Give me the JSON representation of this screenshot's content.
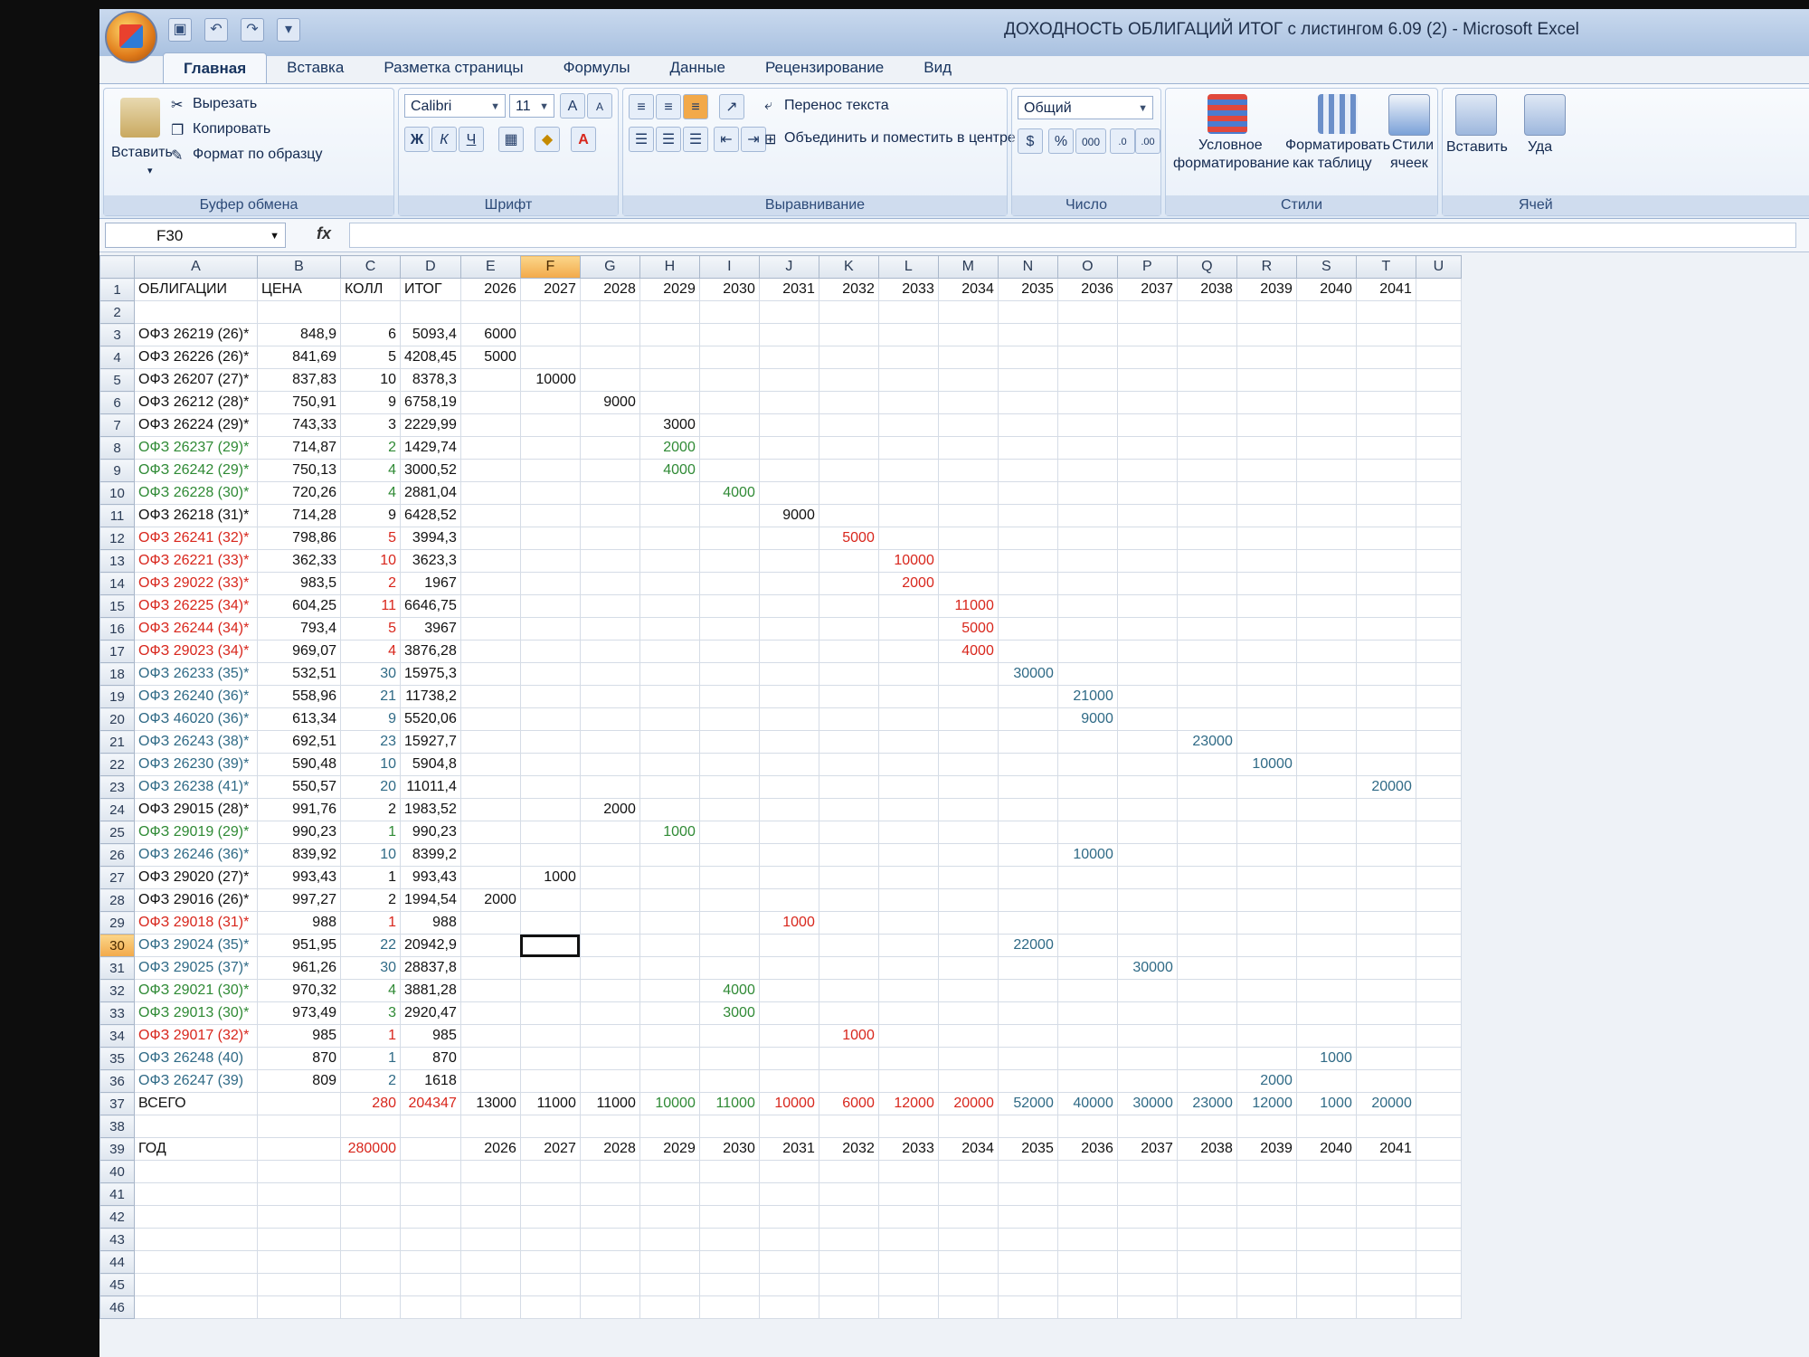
{
  "window": {
    "title": "ДОХОДНОСТЬ ОБЛИГАЦИЙ ИТОГ с листингом 6.09 (2) - Microsoft Excel"
  },
  "ribbon": {
    "tabs": [
      "Главная",
      "Вставка",
      "Разметка страницы",
      "Формулы",
      "Данные",
      "Рецензирование",
      "Вид"
    ],
    "clipboard": {
      "paste": "Вставить",
      "cut": "Вырезать",
      "copy": "Копировать",
      "format_painter": "Формат по образцу",
      "label": "Буфер обмена"
    },
    "font": {
      "name": "Calibri",
      "size": "11",
      "bold": "Ж",
      "italic": "К",
      "underline": "Ч",
      "label": "Шрифт"
    },
    "alignment": {
      "wrap": "Перенос текста",
      "merge": "Объединить и поместить в центре",
      "label": "Выравнивание"
    },
    "number": {
      "format": "Общий",
      "percent": "%",
      "thousands": "000",
      "label": "Число"
    },
    "styles": {
      "conditional": [
        "Условное",
        "форматирование"
      ],
      "as_table": [
        "Форматировать",
        "как таблицу"
      ],
      "cell_styles": [
        "Стили",
        "ячеек"
      ],
      "label": "Стили"
    },
    "cells": {
      "insert": "Вставить",
      "delete": "Уда",
      "label": "Ячей"
    }
  },
  "formula_bar": {
    "name_box": "F30",
    "fx": "fx",
    "content": ""
  },
  "columns": [
    "A",
    "B",
    "C",
    "D",
    "E",
    "F",
    "G",
    "H",
    "I",
    "J",
    "K",
    "L",
    "M",
    "N",
    "O",
    "P",
    "Q",
    "R",
    "S",
    "T",
    "U"
  ],
  "selected_column": "F",
  "selected_row": 30,
  "header_row": [
    "ОБЛИГАЦИИ",
    "ЦЕНА",
    "КОЛЛ",
    "ИТОГ",
    "2026",
    "2027",
    "2028",
    "2029",
    "2030",
    "2031",
    "2032",
    "2033",
    "2034",
    "2035",
    "2036",
    "2037",
    "2038",
    "2039",
    "2040",
    "2041",
    ""
  ],
  "bonds": [
    {
      "name": "ОФЗ 26219 (26)*",
      "price": "848,9",
      "qty": "6",
      "total": "5093,4",
      "col": "E",
      "val": "6000",
      "color": "black"
    },
    {
      "name": "ОФЗ 26226 (26)*",
      "price": "841,69",
      "qty": "5",
      "total": "4208,45",
      "col": "E",
      "val": "5000",
      "color": "black"
    },
    {
      "name": "ОФЗ 26207 (27)*",
      "price": "837,83",
      "qty": "10",
      "total": "8378,3",
      "col": "F",
      "val": "10000",
      "color": "black"
    },
    {
      "name": "ОФЗ 26212 (28)*",
      "price": "750,91",
      "qty": "9",
      "total": "6758,19",
      "col": "G",
      "val": "9000",
      "color": "black"
    },
    {
      "name": "ОФЗ 26224 (29)*",
      "price": "743,33",
      "qty": "3",
      "total": "2229,99",
      "col": "H",
      "val": "3000",
      "color": "black"
    },
    {
      "name": "ОФЗ 26237 (29)*",
      "price": "714,87",
      "qty": "2",
      "total": "1429,74",
      "col": "H",
      "val": "2000",
      "color": "green"
    },
    {
      "name": "ОФЗ 26242 (29)*",
      "price": "750,13",
      "qty": "4",
      "total": "3000,52",
      "col": "H",
      "val": "4000",
      "color": "green"
    },
    {
      "name": "ОФЗ 26228 (30)*",
      "price": "720,26",
      "qty": "4",
      "total": "2881,04",
      "col": "I",
      "val": "4000",
      "color": "green"
    },
    {
      "name": "ОФЗ 26218 (31)*",
      "price": "714,28",
      "qty": "9",
      "total": "6428,52",
      "col": "J",
      "val": "9000",
      "color": "black"
    },
    {
      "name": "ОФЗ 26241 (32)*",
      "price": "798,86",
      "qty": "5",
      "total": "3994,3",
      "col": "K",
      "val": "5000",
      "color": "red"
    },
    {
      "name": "ОФЗ 26221 (33)*",
      "price": "362,33",
      "qty": "10",
      "total": "3623,3",
      "col": "L",
      "val": "10000",
      "color": "red"
    },
    {
      "name": "ОФЗ 29022 (33)*",
      "price": "983,5",
      "qty": "2",
      "total": "1967",
      "col": "L",
      "val": "2000",
      "color": "red"
    },
    {
      "name": "ОФЗ 26225 (34)*",
      "price": "604,25",
      "qty": "11",
      "total": "6646,75",
      "col": "M",
      "val": "11000",
      "color": "red"
    },
    {
      "name": "ОФЗ 26244 (34)*",
      "price": "793,4",
      "qty": "5",
      "total": "3967",
      "col": "M",
      "val": "5000",
      "color": "red"
    },
    {
      "name": "ОФЗ 29023 (34)*",
      "price": "969,07",
      "qty": "4",
      "total": "3876,28",
      "col": "M",
      "val": "4000",
      "color": "red"
    },
    {
      "name": "ОФЗ 26233 (35)*",
      "price": "532,51",
      "qty": "30",
      "total": "15975,3",
      "col": "N",
      "val": "30000",
      "color": "teal"
    },
    {
      "name": "ОФЗ 26240 (36)*",
      "price": "558,96",
      "qty": "21",
      "total": "11738,2",
      "col": "O",
      "val": "21000",
      "color": "teal"
    },
    {
      "name": "ОФЗ 46020 (36)*",
      "price": "613,34",
      "qty": "9",
      "total": "5520,06",
      "col": "O",
      "val": "9000",
      "color": "teal"
    },
    {
      "name": "ОФЗ 26243 (38)*",
      "price": "692,51",
      "qty": "23",
      "total": "15927,7",
      "col": "Q",
      "val": "23000",
      "color": "teal"
    },
    {
      "name": "ОФЗ 26230 (39)*",
      "price": "590,48",
      "qty": "10",
      "total": "5904,8",
      "col": "R",
      "val": "10000",
      "color": "teal"
    },
    {
      "name": "ОФЗ 26238 (41)*",
      "price": "550,57",
      "qty": "20",
      "total": "11011,4",
      "col": "T",
      "val": "20000",
      "color": "teal"
    },
    {
      "name": "ОФЗ 29015 (28)*",
      "price": "991,76",
      "qty": "2",
      "total": "1983,52",
      "col": "G",
      "val": "2000",
      "color": "black"
    },
    {
      "name": "ОФЗ 29019 (29)*",
      "price": "990,23",
      "qty": "1",
      "total": "990,23",
      "col": "H",
      "val": "1000",
      "color": "green"
    },
    {
      "name": "ОФЗ 26246 (36)*",
      "price": "839,92",
      "qty": "10",
      "total": "8399,2",
      "col": "O",
      "val": "10000",
      "color": "teal"
    },
    {
      "name": "ОФЗ 29020 (27)*",
      "price": "993,43",
      "qty": "1",
      "total": "993,43",
      "col": "F",
      "val": "1000",
      "color": "black"
    },
    {
      "name": "ОФЗ 29016 (26)*",
      "price": "997,27",
      "qty": "2",
      "total": "1994,54",
      "col": "E",
      "val": "2000",
      "color": "black"
    },
    {
      "name": "ОФЗ 29018 (31)*",
      "price": "988",
      "qty": "1",
      "total": "988",
      "col": "J",
      "val": "1000",
      "color": "red"
    },
    {
      "name": "ОФЗ 29024 (35)*",
      "price": "951,95",
      "qty": "22",
      "total": "20942,9",
      "col": "N",
      "val": "22000",
      "color": "teal"
    },
    {
      "name": "ОФЗ 29025 (37)*",
      "price": "961,26",
      "qty": "30",
      "total": "28837,8",
      "col": "P",
      "val": "30000",
      "color": "teal"
    },
    {
      "name": "ОФЗ 29021 (30)*",
      "price": "970,32",
      "qty": "4",
      "total": "3881,28",
      "col": "I",
      "val": "4000",
      "color": "green"
    },
    {
      "name": "ОФЗ 29013 (30)*",
      "price": "973,49",
      "qty": "3",
      "total": "2920,47",
      "col": "I",
      "val": "3000",
      "color": "green"
    },
    {
      "name": "ОФЗ 29017 (32)*",
      "price": "985",
      "qty": "1",
      "total": "985",
      "col": "K",
      "val": "1000",
      "color": "red"
    },
    {
      "name": "ОФЗ 26248 (40)",
      "price": "870",
      "qty": "1",
      "total": "870",
      "col": "S",
      "val": "1000",
      "color": "teal"
    },
    {
      "name": "ОФЗ 26247 (39)",
      "price": "809",
      "qty": "2",
      "total": "1618",
      "col": "R",
      "val": "2000",
      "color": "teal"
    }
  ],
  "totals": {
    "label": "ВСЕГО",
    "qty": "280",
    "total": "204347",
    "years": [
      "13000",
      "11000",
      "11000",
      "10000",
      "11000",
      "10000",
      "6000",
      "12000",
      "20000",
      "52000",
      "40000",
      "30000",
      "23000",
      "12000",
      "1000",
      "20000"
    ],
    "year_colors": [
      "black",
      "black",
      "black",
      "green",
      "green",
      "red",
      "red",
      "red",
      "red",
      "teal",
      "teal",
      "teal",
      "teal",
      "teal",
      "teal",
      "teal"
    ]
  },
  "year_row": {
    "label": "ГОД",
    "qty": "280000",
    "years": [
      "2026",
      "2027",
      "2028",
      "2029",
      "2030",
      "2031",
      "2032",
      "2033",
      "2034",
      "2035",
      "2036",
      "2037",
      "2038",
      "2039",
      "2040",
      "2041"
    ]
  },
  "visible_rows": 46,
  "colors": {
    "red": "#d8261c",
    "green": "#2f8a35",
    "teal": "#2f6a86",
    "black": "#111111",
    "selection": "#f2a94a"
  }
}
